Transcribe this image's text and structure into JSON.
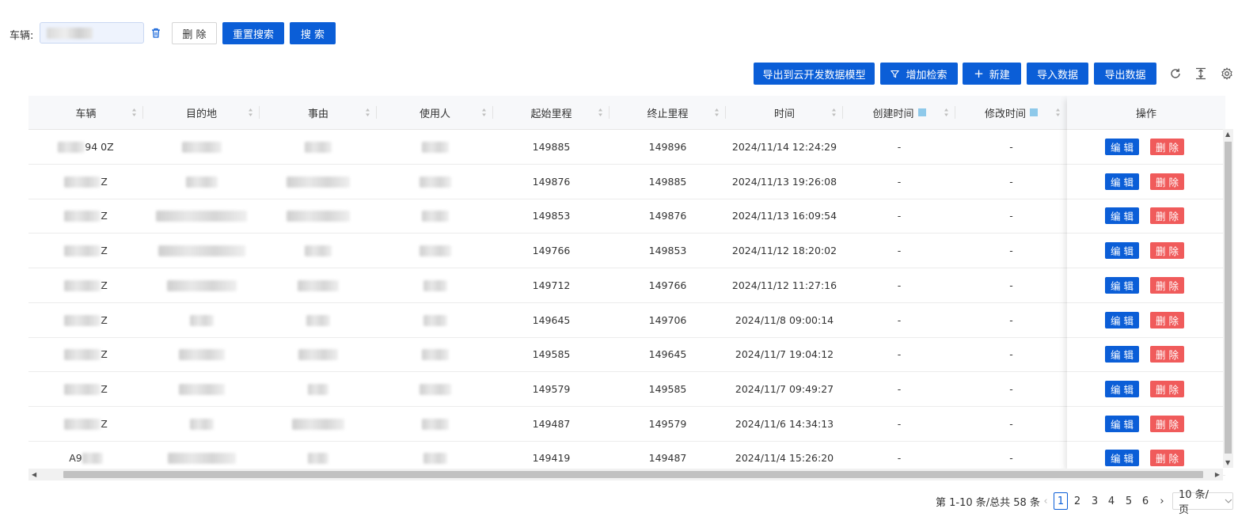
{
  "search": {
    "label": "车辆:",
    "value_masked": true,
    "delete_label": "删 除",
    "reset_label": "重置搜索",
    "search_label": "搜 索"
  },
  "toolbar": {
    "export_model_label": "导出到云开发数据模型",
    "add_filter_label": "增加检索",
    "new_label": "新建",
    "import_label": "导入数据",
    "export_label": "导出数据",
    "icons": [
      "refresh-icon",
      "density-icon",
      "settings-icon"
    ]
  },
  "table": {
    "columns": [
      "车辆",
      "目的地",
      "事由",
      "使用人",
      "起始里程",
      "终止里程",
      "时间",
      "创建时间",
      "修改时间",
      "操作"
    ],
    "rows": [
      {
        "vehicle_suffix": "94 0Z",
        "start": "149885",
        "end": "149896",
        "time": "2024/11/14 12:24:29",
        "created": "-",
        "modified": "-"
      },
      {
        "vehicle_suffix": "Z",
        "start": "149876",
        "end": "149885",
        "time": "2024/11/13 19:26:08",
        "created": "-",
        "modified": "-"
      },
      {
        "vehicle_suffix": "Z",
        "start": "149853",
        "end": "149876",
        "time": "2024/11/13 16:09:54",
        "created": "-",
        "modified": "-"
      },
      {
        "vehicle_suffix": "Z",
        "start": "149766",
        "end": "149853",
        "time": "2024/11/12 18:20:02",
        "created": "-",
        "modified": "-"
      },
      {
        "vehicle_suffix": "Z",
        "start": "149712",
        "end": "149766",
        "time": "2024/11/12 11:27:16",
        "created": "-",
        "modified": "-"
      },
      {
        "vehicle_suffix": "Z",
        "start": "149645",
        "end": "149706",
        "time": "2024/11/8 09:00:14",
        "created": "-",
        "modified": "-"
      },
      {
        "vehicle_suffix": "Z",
        "start": "149585",
        "end": "149645",
        "time": "2024/11/7 19:04:12",
        "created": "-",
        "modified": "-"
      },
      {
        "vehicle_suffix": "Z",
        "start": "149579",
        "end": "149585",
        "time": "2024/11/7 09:49:27",
        "created": "-",
        "modified": "-"
      },
      {
        "vehicle_suffix": "Z",
        "start": "149487",
        "end": "149579",
        "time": "2024/11/6 14:34:13",
        "created": "-",
        "modified": "-"
      },
      {
        "vehicle_suffix": "A9",
        "start": "149419",
        "end": "149487",
        "time": "2024/11/4 15:26:20",
        "created": "-",
        "modified": "-"
      }
    ],
    "edit_label": "编 辑",
    "delete_label": "删 除"
  },
  "pagination": {
    "summary": "第 1-10 条/总共 58 条",
    "pages": [
      "1",
      "2",
      "3",
      "4",
      "5",
      "6"
    ],
    "current": "1",
    "page_size": "10 条/页"
  },
  "colors": {
    "primary": "#0b5ed7",
    "danger": "#f05b5b"
  }
}
